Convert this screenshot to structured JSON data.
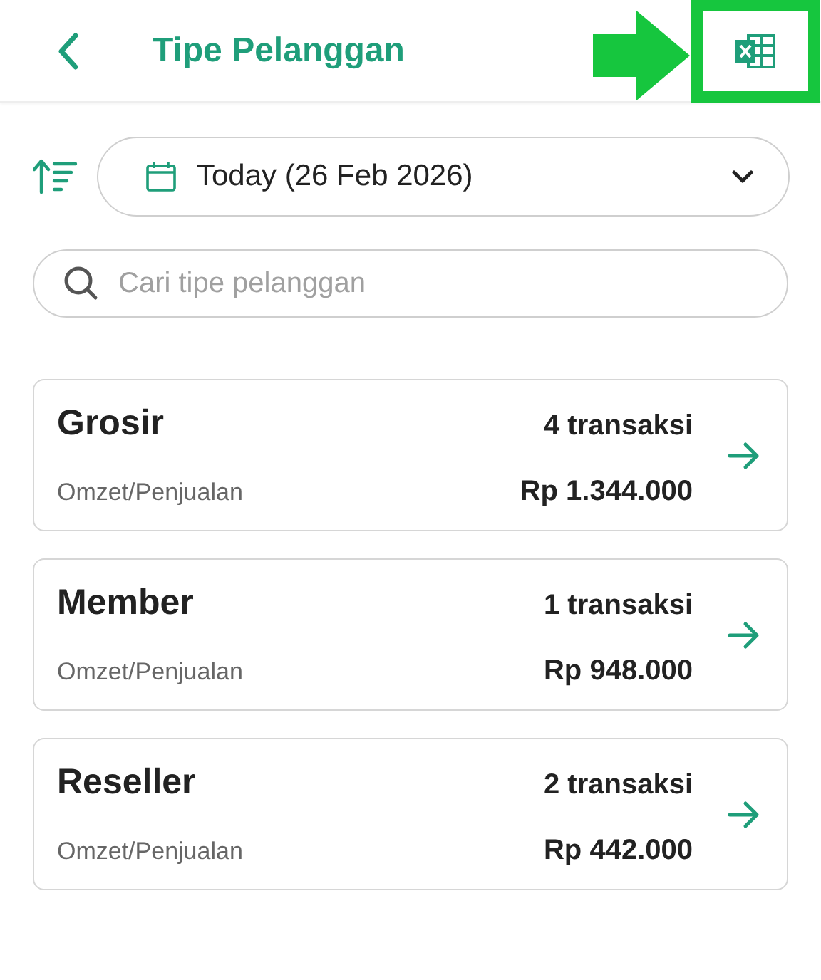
{
  "header": {
    "title": "Tipe Pelanggan"
  },
  "date_filter": {
    "value": "Today (26 Feb 2026)"
  },
  "search": {
    "placeholder": "Cari tipe pelanggan"
  },
  "customer_types": [
    {
      "name": "Grosir",
      "transactions": "4 transaksi",
      "label": "Omzet/Penjualan",
      "amount": "Rp 1.344.000"
    },
    {
      "name": "Member",
      "transactions": "1 transaksi",
      "label": "Omzet/Penjualan",
      "amount": "Rp 948.000"
    },
    {
      "name": "Reseller",
      "transactions": "2 transaksi",
      "label": "Omzet/Penjualan",
      "amount": "Rp 442.000"
    }
  ]
}
